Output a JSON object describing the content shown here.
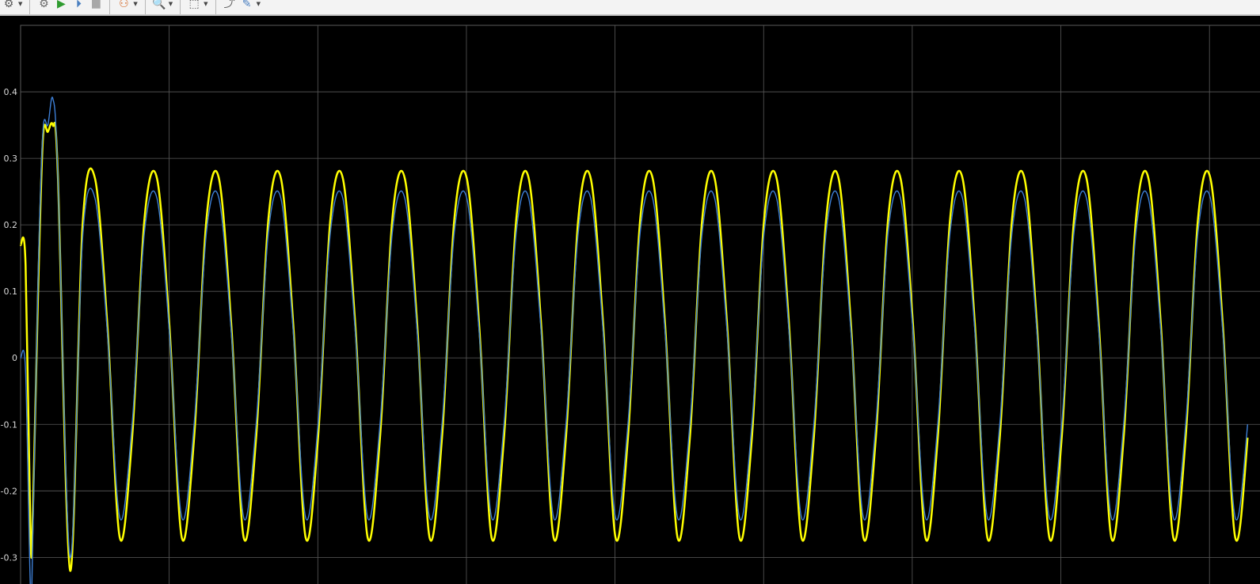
{
  "toolbar": {
    "buttons": [
      {
        "icon": "gear-icon",
        "glyph": "⚙",
        "color": "#5a5a5a",
        "dropdown": true
      },
      {
        "icon": "scope-settings-icon",
        "glyph": "⚙",
        "color": "#6a6a6a",
        "dropdown": false
      },
      {
        "icon": "run-icon",
        "glyph": "▶",
        "color": "#2e9b2e",
        "dropdown": false
      },
      {
        "icon": "step-forward-icon",
        "glyph": "⏵",
        "color": "#4a7fc0",
        "dropdown": false
      },
      {
        "icon": "stop-icon",
        "glyph": "■",
        "color": "#a8a8a8",
        "dropdown": false
      },
      {
        "icon": "highlight-block-icon",
        "glyph": "⚇",
        "color": "#d46a2a",
        "dropdown": true
      },
      {
        "icon": "zoom-in-icon",
        "glyph": "🔍",
        "color": "#555555",
        "dropdown": true
      },
      {
        "icon": "autoscale-icon",
        "glyph": "⬚",
        "color": "#555555",
        "dropdown": true
      },
      {
        "icon": "restore-view-icon",
        "glyph": "⤴",
        "color": "#555555",
        "dropdown": false
      },
      {
        "icon": "measurement-icon",
        "glyph": "✎",
        "color": "#4a7fc0",
        "dropdown": true
      }
    ]
  },
  "chart_data": {
    "type": "line",
    "title": "",
    "xlabel": "",
    "ylabel": "",
    "ylim": [
      -0.34,
      0.5
    ],
    "yticks": [
      0.4,
      0.3,
      0.2,
      0.1,
      0,
      -0.1,
      -0.2,
      -0.3
    ],
    "ytick_labels": [
      "0.4",
      "0.3",
      "0.2",
      "0.1",
      "0",
      "-0.1",
      "-0.2",
      "-0.3"
    ],
    "vertical_gridlines": 8,
    "grid": true,
    "background": "#000000",
    "grid_color": "#5a5a5a",
    "x": [
      0,
      0.02,
      0.04,
      0.05,
      0.07,
      0.09,
      0.11,
      0.13,
      0.15,
      0.2,
      0.25,
      0.3,
      0.35,
      0.4,
      0.45,
      0.5,
      0.55,
      0.6,
      0.65,
      0.7,
      0.75,
      0.8,
      0.85,
      0.9,
      0.95,
      1.0,
      1.05,
      1.1,
      1.15,
      1.2,
      1.25,
      1.3,
      1.35,
      1.4,
      1.45,
      1.5,
      1.55,
      1.6,
      1.65,
      1.7,
      1.75,
      1.8,
      1.85,
      1.9,
      1.95,
      2.0,
      2.05,
      2.1,
      2.15,
      2.2,
      2.25,
      2.3,
      2.35,
      2.4,
      2.45,
      2.5,
      2.55,
      2.6,
      2.65,
      2.7,
      2.75,
      2.8,
      2.85,
      2.9,
      2.95,
      3.0,
      3.05,
      3.1,
      3.15,
      3.2,
      3.25,
      3.3,
      3.35,
      3.4,
      3.45,
      3.5,
      3.55,
      3.6,
      3.65,
      3.7,
      3.75,
      3.8,
      3.85,
      3.9,
      3.95,
      4.0,
      4.05,
      4.1,
      4.15,
      4.2,
      4.25,
      4.3,
      4.35,
      4.4,
      4.45,
      4.5,
      4.55,
      4.6,
      4.65,
      4.7,
      4.75,
      4.8,
      4.85,
      4.9,
      4.95,
      5.0
    ],
    "series": [
      {
        "color": "#ffff00",
        "width": 2.5,
        "values": [
          0.17,
          0.14,
          -0.27,
          -0.23,
          0.09,
          0.33,
          0.34,
          0.35,
          0.28,
          -0.32,
          0.2,
          0.27,
          0.05,
          -0.27,
          -0.12,
          0.21,
          0.27,
          0.05,
          -0.27,
          -0.12,
          0.21,
          0.27,
          0.05,
          -0.27,
          -0.12,
          0.21,
          0.27,
          0.05,
          -0.27,
          -0.12,
          0.21,
          0.27,
          0.05,
          -0.27,
          -0.12,
          0.21,
          0.27,
          0.05,
          -0.27,
          -0.12,
          0.21,
          0.27,
          0.05,
          -0.27,
          -0.12,
          0.21,
          0.27,
          0.05,
          -0.27,
          -0.12,
          0.21,
          0.27,
          0.05,
          -0.27,
          -0.12,
          0.21,
          0.27,
          0.05,
          -0.27,
          -0.12,
          0.21,
          0.27,
          0.05,
          -0.27,
          -0.12,
          0.21,
          0.27,
          0.05,
          -0.27,
          -0.12,
          0.21,
          0.27,
          0.05,
          -0.27,
          -0.12,
          0.21,
          0.27,
          0.05,
          -0.27,
          -0.12,
          0.21,
          0.27,
          0.05,
          -0.27,
          -0.12,
          0.21,
          0.27,
          0.05,
          -0.27,
          -0.12,
          0.21,
          0.27,
          0.05,
          -0.27,
          -0.12,
          0.21,
          0.27,
          0.05,
          -0.27,
          -0.12,
          0.21,
          0.27,
          0.05,
          -0.27,
          -0.12,
          0.21,
          0.27
        ]
      },
      {
        "color": "#3d7fd6",
        "width": 1.4,
        "values": [
          0.0,
          -0.02,
          -0.35,
          -0.26,
          0.11,
          0.34,
          0.35,
          0.39,
          0.28,
          -0.3,
          0.18,
          0.24,
          0.04,
          -0.24,
          -0.1,
          0.19,
          0.24,
          0.04,
          -0.24,
          -0.1,
          0.19,
          0.24,
          0.04,
          -0.24,
          -0.1,
          0.19,
          0.24,
          0.04,
          -0.24,
          -0.1,
          0.19,
          0.24,
          0.04,
          -0.24,
          -0.1,
          0.19,
          0.24,
          0.04,
          -0.24,
          -0.1,
          0.19,
          0.24,
          0.04,
          -0.24,
          -0.1,
          0.19,
          0.24,
          0.04,
          -0.24,
          -0.1,
          0.19,
          0.24,
          0.04,
          -0.24,
          -0.1,
          0.19,
          0.24,
          0.04,
          -0.24,
          -0.1,
          0.19,
          0.24,
          0.04,
          -0.24,
          -0.1,
          0.19,
          0.24,
          0.04,
          -0.24,
          -0.1,
          0.19,
          0.24,
          0.04,
          -0.24,
          -0.1,
          0.19,
          0.24,
          0.04,
          -0.24,
          -0.1,
          0.19,
          0.24,
          0.04,
          -0.24,
          -0.1,
          0.19,
          0.24,
          0.04,
          -0.24,
          -0.1,
          0.19,
          0.24,
          0.04,
          -0.24,
          -0.1,
          0.19,
          0.24,
          0.04,
          -0.24,
          -0.1,
          0.19,
          0.24,
          0.04,
          -0.24,
          -0.1,
          0.19,
          0.24
        ]
      }
    ]
  }
}
